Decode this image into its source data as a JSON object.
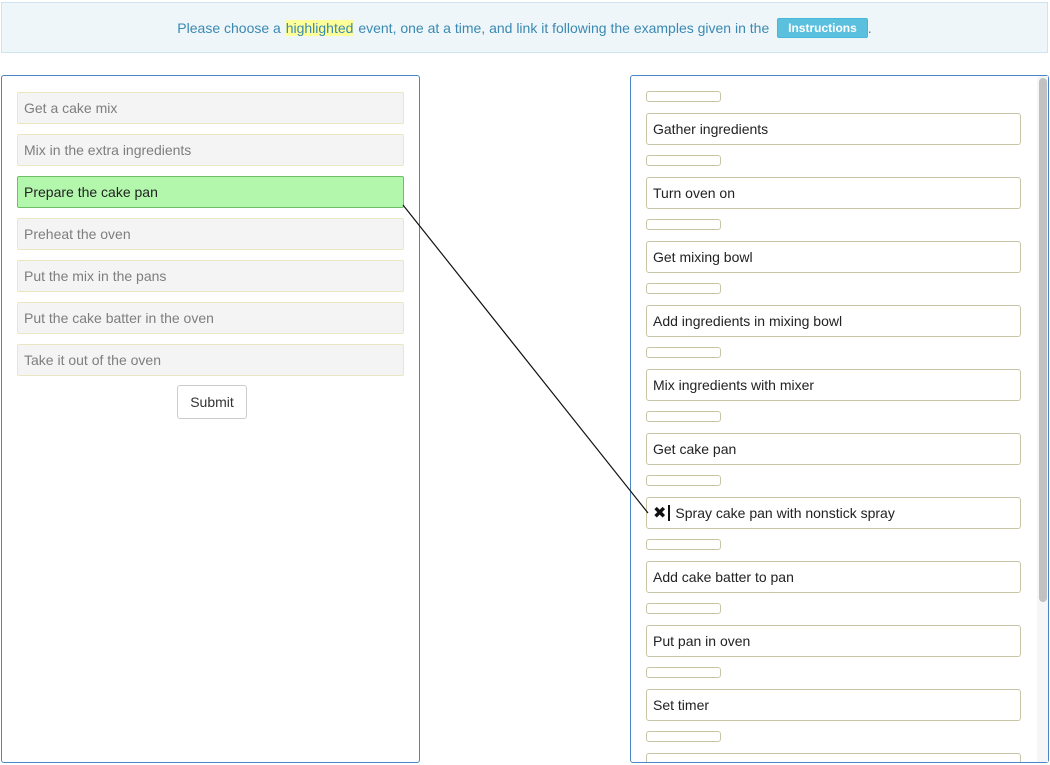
{
  "banner": {
    "text_before": "Please choose a ",
    "highlight": "highlighted",
    "text_after": " event, one at a time, and link it following the examples given in the ",
    "instructions_label": "Instructions",
    "period": "."
  },
  "left": {
    "events": [
      {
        "label": "Get a cake mix",
        "selected": false
      },
      {
        "label": "Mix in the extra ingredients",
        "selected": false
      },
      {
        "label": "Prepare the cake pan",
        "selected": true
      },
      {
        "label": "Preheat the oven",
        "selected": false
      },
      {
        "label": "Put the mix in the pans",
        "selected": false
      },
      {
        "label": "Put the cake batter in the oven",
        "selected": false
      },
      {
        "label": "Take it out of the oven",
        "selected": false
      }
    ],
    "submit_label": "Submit"
  },
  "right": {
    "steps": [
      {
        "label": "Gather ingredients",
        "linked": false
      },
      {
        "label": "Turn oven on",
        "linked": false
      },
      {
        "label": "Get mixing bowl",
        "linked": false
      },
      {
        "label": "Add ingredients in mixing bowl",
        "linked": false
      },
      {
        "label": "Mix ingredients with mixer",
        "linked": false
      },
      {
        "label": "Get cake pan",
        "linked": false
      },
      {
        "label": "Spray cake pan with nonstick spray",
        "linked": true
      },
      {
        "label": "Add cake batter to pan",
        "linked": false
      },
      {
        "label": "Put pan in oven",
        "linked": false
      },
      {
        "label": "Set timer",
        "linked": false
      }
    ],
    "remove_link_icon": "close-x-icon"
  },
  "colors": {
    "selected_bg": "#b3f7ad",
    "panel_border": "#4a86c5",
    "banner_text": "#3a89b3",
    "instructions_bg": "#5bc0de"
  }
}
